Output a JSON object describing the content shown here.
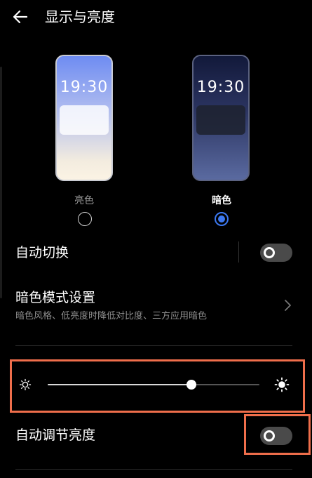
{
  "header": {
    "title": "显示与亮度",
    "back_icon": "arrow-left-icon"
  },
  "preview": {
    "light": {
      "time": "19:30",
      "label": "亮色",
      "selected": false
    },
    "dark": {
      "time": "19:30",
      "label": "暗色",
      "selected": true
    }
  },
  "auto_switch": {
    "label": "自动切换",
    "enabled": false
  },
  "dark_mode_settings": {
    "label": "暗色模式设置",
    "description": "暗色风格、低亮度时降低对比度、三方应用暗色",
    "icon": "chevron-right-icon"
  },
  "brightness": {
    "level_fraction": 0.68,
    "min_icon": "sun-small-icon",
    "max_icon": "sun-large-icon"
  },
  "auto_brightness": {
    "label": "自动调节亮度",
    "enabled": false
  },
  "colors": {
    "accent": "#3c78f0",
    "highlight": "#ef6e4b",
    "background": "#000000",
    "toggle_off": "#4a4a4a"
  }
}
